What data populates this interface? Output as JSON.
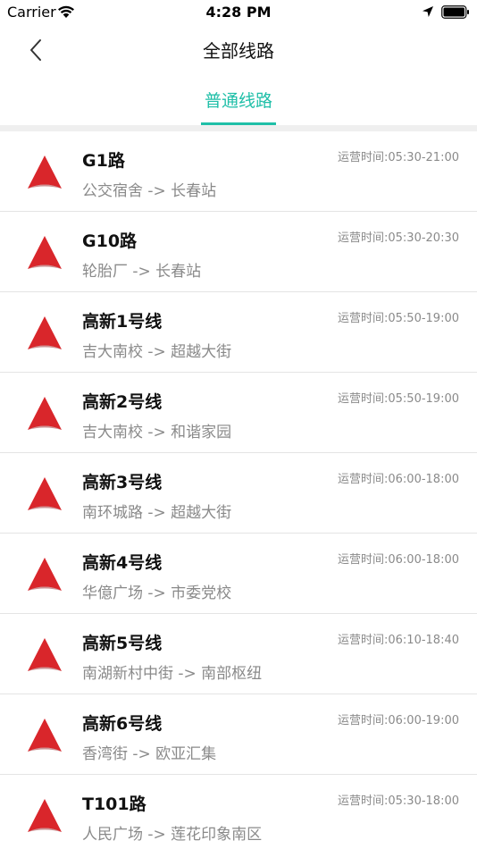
{
  "status_bar": {
    "carrier": "Carrier",
    "time": "4:28 PM"
  },
  "nav": {
    "title": "全部线路",
    "back_icon": "chevron-left-icon"
  },
  "tabs": [
    {
      "label": "普通线路",
      "active": true
    }
  ],
  "colors": {
    "accent": "#1fbfa8",
    "route_icon": "#d9262b",
    "secondary_text": "#8a8a8a"
  },
  "routes": [
    {
      "name": "G1路",
      "direction": "公交宿舍 -> 长春站",
      "hours": "运营时间:05:30-21:00"
    },
    {
      "name": "G10路",
      "direction": "轮胎厂 -> 长春站",
      "hours": "运营时间:05:30-20:30"
    },
    {
      "name": "高新1号线",
      "direction": "吉大南校 -> 超越大街",
      "hours": "运营时间:05:50-19:00"
    },
    {
      "name": "高新2号线",
      "direction": "吉大南校 -> 和谐家园",
      "hours": "运营时间:05:50-19:00"
    },
    {
      "name": "高新3号线",
      "direction": "南环城路 -> 超越大街",
      "hours": "运营时间:06:00-18:00"
    },
    {
      "name": "高新4号线",
      "direction": "华億广场 -> 市委党校",
      "hours": "运营时间:06:00-18:00"
    },
    {
      "name": "高新5号线",
      "direction": "南湖新村中街 -> 南部枢纽",
      "hours": "运营时间:06:10-18:40"
    },
    {
      "name": "高新6号线",
      "direction": "香湾街 -> 欧亚汇集",
      "hours": "运营时间:06:00-19:00"
    },
    {
      "name": "T101路",
      "direction": "人民广场 -> 莲花印象南区",
      "hours": "运营时间:05:30-18:00"
    }
  ]
}
